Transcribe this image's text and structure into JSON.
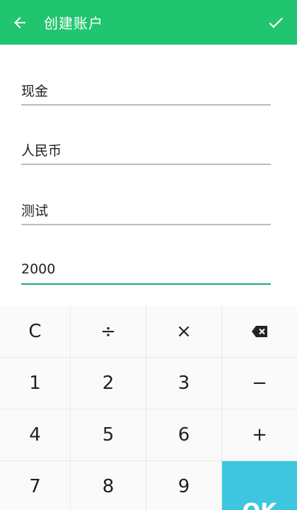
{
  "appbar": {
    "title": "创建账户",
    "back_icon": "arrow-left-icon",
    "confirm_icon": "check-icon",
    "background": "#21c56f"
  },
  "form": {
    "fields": [
      {
        "value": "现金"
      },
      {
        "value": "人民币"
      },
      {
        "value": "测试"
      },
      {
        "value": "2000"
      }
    ],
    "active_underline": "#1fa58b"
  },
  "keypad": {
    "rows": [
      [
        "C",
        "÷",
        "×",
        "⌫"
      ],
      [
        "1",
        "2",
        "3",
        "−"
      ],
      [
        "4",
        "5",
        "6",
        "+"
      ],
      [
        "7",
        "8",
        "9"
      ]
    ],
    "ok_label": "OK",
    "ok_color": "#3ec6e0"
  }
}
